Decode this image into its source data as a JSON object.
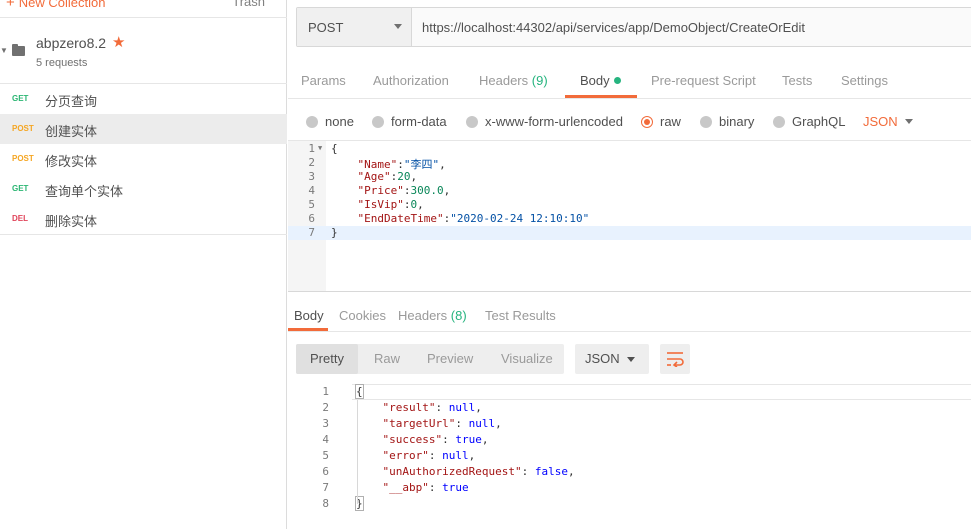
{
  "sidebar": {
    "new_collection": "New Collection",
    "trash": "Trash",
    "collection": {
      "name": "abpzero8.2",
      "sub": "5 requests"
    },
    "requests": [
      {
        "method": "GET",
        "name": "分页查询",
        "color": "#2bb673"
      },
      {
        "method": "POST",
        "name": "创建实体",
        "color": "#f5a623"
      },
      {
        "method": "POST",
        "name": "修改实体",
        "color": "#f5a623"
      },
      {
        "method": "GET",
        "name": "查询单个实体",
        "color": "#2bb673"
      },
      {
        "method": "DEL",
        "name": "删除实体",
        "color": "#e0445a"
      }
    ]
  },
  "request": {
    "method": "POST",
    "url": "https://localhost:44302/api/services/app/DemoObject/CreateOrEdit"
  },
  "tabs": {
    "params": "Params",
    "authorization": "Authorization",
    "headers": "Headers",
    "headers_count": "(9)",
    "body": "Body",
    "prerequest": "Pre-request Script",
    "tests": "Tests",
    "settings": "Settings"
  },
  "body_options": {
    "none": "none",
    "form_data": "form-data",
    "urlencoded": "x-www-form-urlencoded",
    "raw": "raw",
    "binary": "binary",
    "graphql": "GraphQL",
    "format": "JSON"
  },
  "request_body": {
    "line_numbers": [
      "1",
      "2",
      "3",
      "4",
      "5",
      "6",
      "7"
    ],
    "open": "{",
    "close": "}",
    "name_key": "\"Name\"",
    "name_val": "\"李四\"",
    "age_key": "\"Age\"",
    "age_val": "20",
    "price_key": "\"Price\"",
    "price_val": "300.0",
    "isvip_key": "\"IsVip\"",
    "isvip_val": "0",
    "enddate_key": "\"EndDateTime\"",
    "enddate_val": "\"2020-02-24 12:10:10\""
  },
  "response_tabs": {
    "body": "Body",
    "cookies": "Cookies",
    "headers": "Headers",
    "headers_count": "(8)",
    "test_results": "Test Results"
  },
  "response_tools": {
    "pretty": "Pretty",
    "raw": "Raw",
    "preview": "Preview",
    "visualize": "Visualize",
    "format": "JSON"
  },
  "response_body": {
    "line_numbers": [
      "1",
      "2",
      "3",
      "4",
      "5",
      "6",
      "7",
      "8"
    ],
    "open": "{",
    "close": "}",
    "result_key": "\"result\"",
    "result_val": "null",
    "targeturl_key": "\"targetUrl\"",
    "targeturl_val": "null",
    "success_key": "\"success\"",
    "success_val": "true",
    "error_key": "\"error\"",
    "error_val": "null",
    "unauth_key": "\"unAuthorizedRequest\"",
    "unauth_val": "false",
    "abp_key": "\"__abp\"",
    "abp_val": "true"
  },
  "colors": {
    "accent": "#f26b3a",
    "green": "#26b47f"
  }
}
